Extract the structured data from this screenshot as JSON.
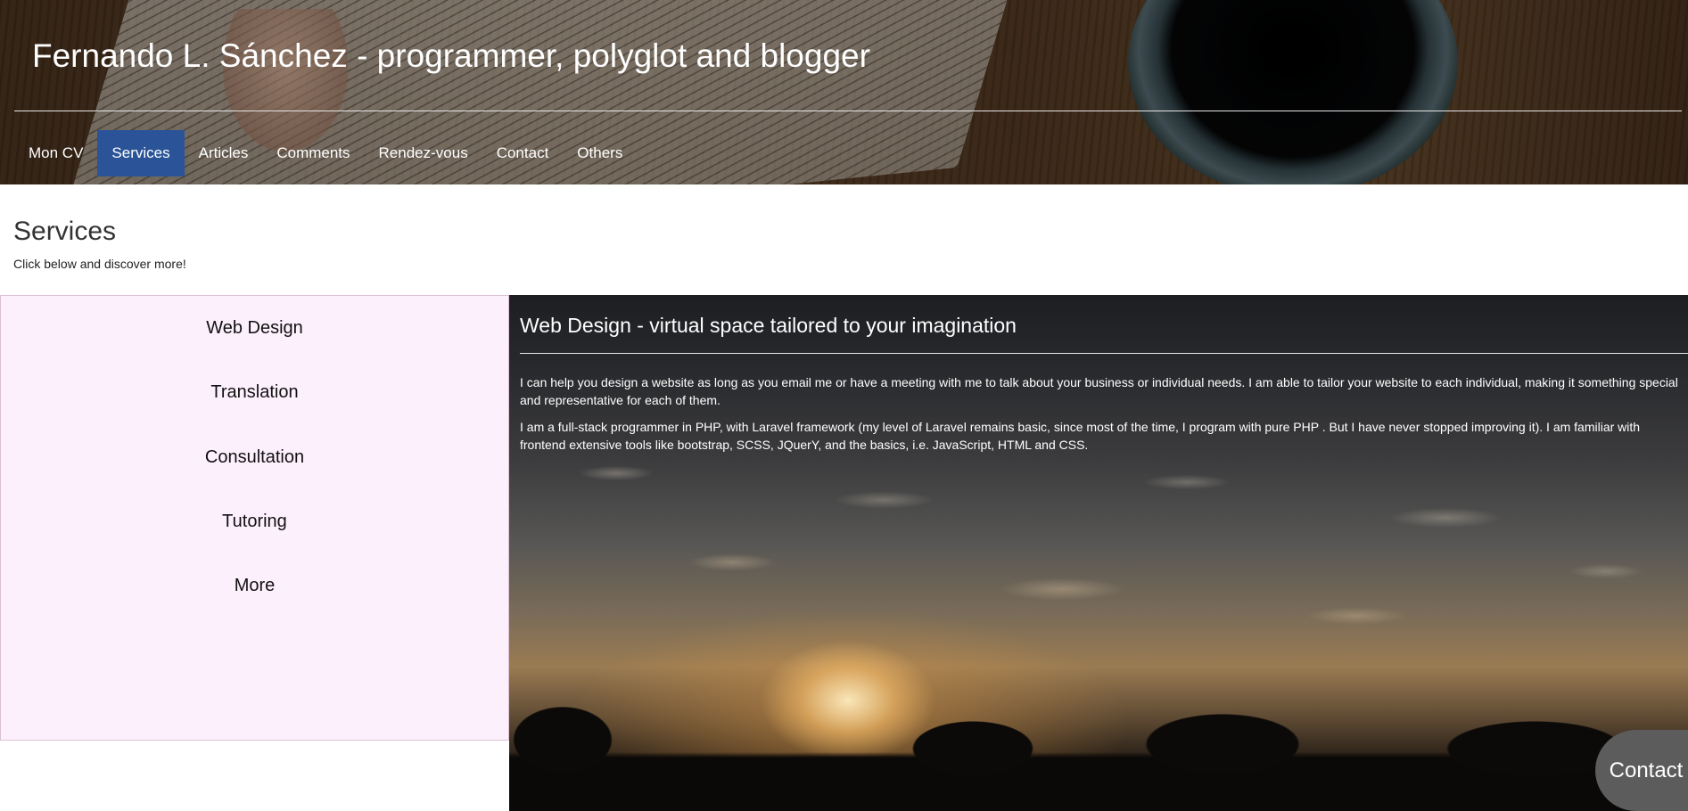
{
  "header": {
    "site_title": "Fernando L. Sánchez - programmer, polyglot and blogger"
  },
  "nav": {
    "items": [
      {
        "label": "Mon CV"
      },
      {
        "label": "Services"
      },
      {
        "label": "Articles"
      },
      {
        "label": "Comments"
      },
      {
        "label": "Rendez-vous"
      },
      {
        "label": "Contact"
      },
      {
        "label": "Others"
      }
    ],
    "active": "Services",
    "active_color": "#2a5497"
  },
  "page": {
    "title": "Services",
    "subtitle": "Click below and discover more!"
  },
  "sidebar": {
    "items": [
      {
        "label": "Web Design"
      },
      {
        "label": "Translation"
      },
      {
        "label": "Consultation"
      },
      {
        "label": "Tutoring"
      },
      {
        "label": "More"
      }
    ],
    "background": "#fdf0fd"
  },
  "panel": {
    "title": "Web Design - virtual space tailored to your imagination",
    "paragraphs": [
      "I can help you design a website as long as you email me or have a meeting with me to talk about your business or individual needs. I am able to tailor your website to each individual, making it something special and representative for each of them.",
      "I am a full-stack programmer in PHP, with Laravel framework (my level of Laravel remains basic, since most of the time, I program with pure PHP . But I have never stopped improving it). I am familiar with frontend extensive tools like bootstrap, SCSS, JQuerY, and the basics, i.e. JavaScript, HTML and CSS."
    ]
  },
  "contact_button": {
    "label": "Contact"
  }
}
